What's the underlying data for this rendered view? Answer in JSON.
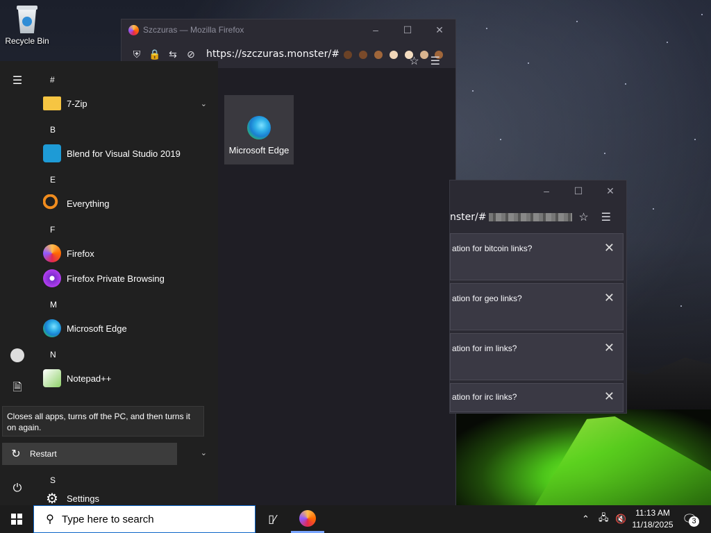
{
  "desktop": {
    "recycle_bin_label": "Recycle Bin"
  },
  "firefox_main": {
    "title": "Szczuras — Mozilla Firefox",
    "url": "https://szczuras.monster/#",
    "url_emojis": [
      "dark-skin-face-icon",
      "medium-dark-face-icon",
      "medium-face-icon",
      "light-face-icon",
      "light-face-icon",
      "medium-light-face-icon",
      "medium-face-icon"
    ],
    "tile_label": "Microsoft Edge"
  },
  "firefox_second": {
    "url_fragment": "nster/#",
    "prompts": [
      "ation for bitcoin links?",
      "ation for geo links?",
      "ation for im links?",
      "ation for irc links?"
    ]
  },
  "start_menu": {
    "letters": [
      "#",
      "B",
      "E",
      "F",
      "M",
      "N",
      "S"
    ],
    "apps": {
      "zip": "7-Zip",
      "blend": "Blend for Visual Studio 2019",
      "everything": "Everything",
      "firefox": "Firefox",
      "firefox_private": "Firefox Private Browsing",
      "edge": "Microsoft Edge",
      "notepad": "Notepad++",
      "settings": "Settings"
    },
    "tooltip": "Closes all apps, turns off the PC, and then turns it on again.",
    "restart_label": "Restart"
  },
  "taskbar": {
    "search_placeholder": "Type here to search",
    "time": "11:13 AM",
    "date": "11/18/2025",
    "notification_count": "3"
  },
  "colors": {
    "firefox_bg": "#2b2a33",
    "start_bg": "#202020",
    "taskbar_bg": "#1c1c1c",
    "accent": "#0a64c8"
  }
}
